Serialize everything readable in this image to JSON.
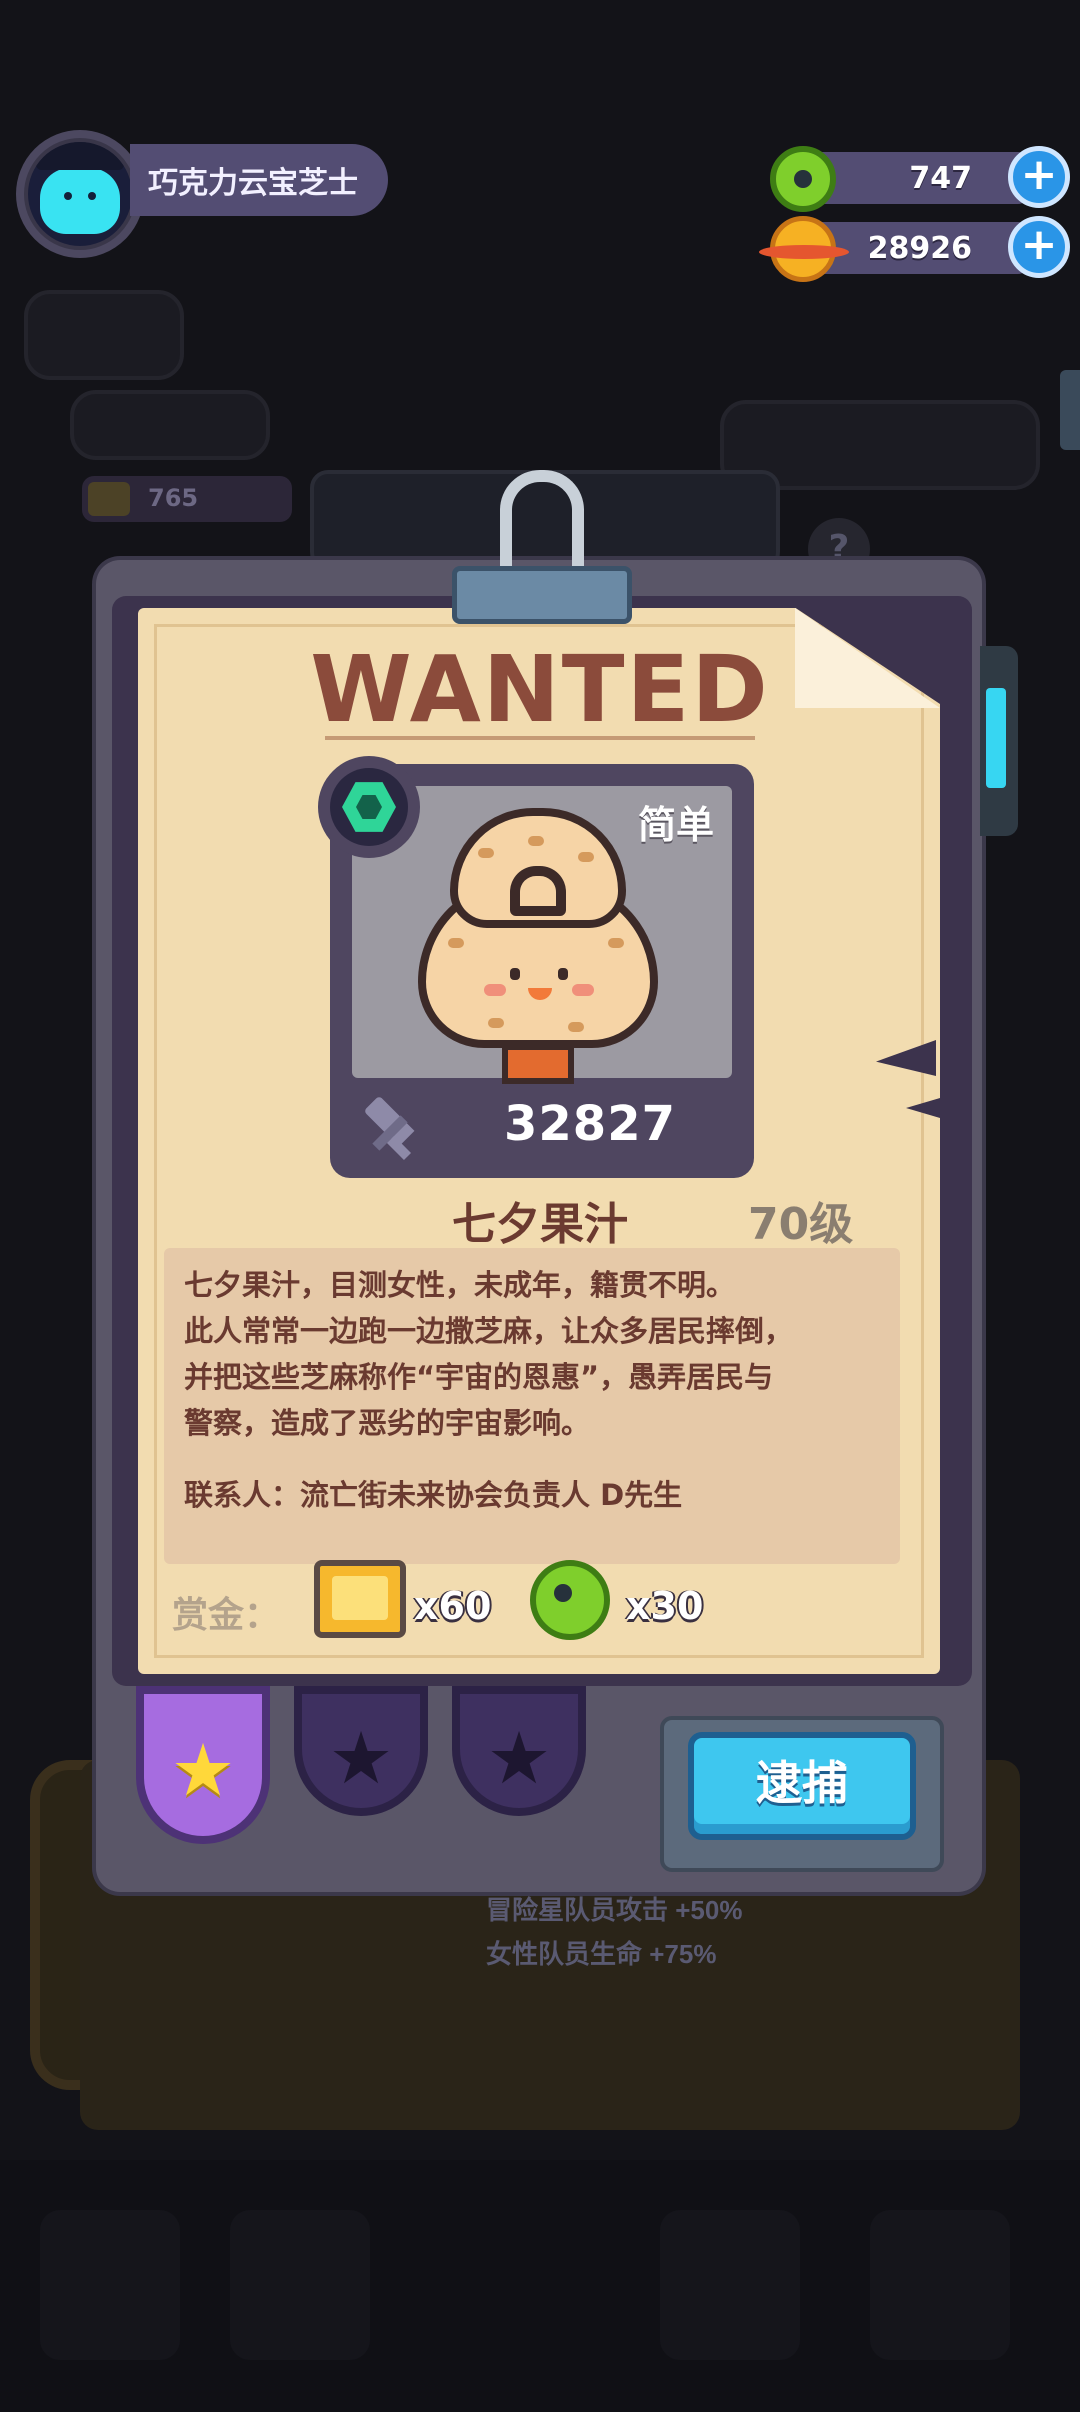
{
  "player": {
    "name": "巧克力云宝芝士"
  },
  "resources": [
    {
      "icon": "donut-icon",
      "value": "747"
    },
    {
      "icon": "planet-coin-icon",
      "value": "28926"
    }
  ],
  "background": {
    "stat_value": "765",
    "buffs": [
      "冒险星队员攻击 +50%",
      "女性队员生命 +75%"
    ],
    "help": "?"
  },
  "wanted": {
    "header": "WANTED",
    "difficulty": "简单",
    "power": "32827",
    "name": "七夕果汁",
    "level": "70级",
    "description": [
      "七夕果汁，目测女性，未成年，籍贯不明。",
      "此人常常一边跑一边撒芝麻，让众多居民摔倒，",
      "并把这些芝麻称作“宇宙的恩惠”，愚弄居民与",
      "警察，造成了恶劣的宇宙影响。",
      "",
      "联系人：流亡街未来协会负责人 D先生"
    ],
    "reward_label": "赏金：",
    "rewards": [
      {
        "icon": "treasure-box-icon",
        "qty": "x60"
      },
      {
        "icon": "donut-icon",
        "qty": "x30"
      }
    ],
    "tabs": [
      {
        "name": "star-tab-1",
        "active": true
      },
      {
        "name": "star-tab-2",
        "active": false
      },
      {
        "name": "star-tab-3",
        "active": false
      }
    ],
    "arrest_label": "逮捕"
  }
}
